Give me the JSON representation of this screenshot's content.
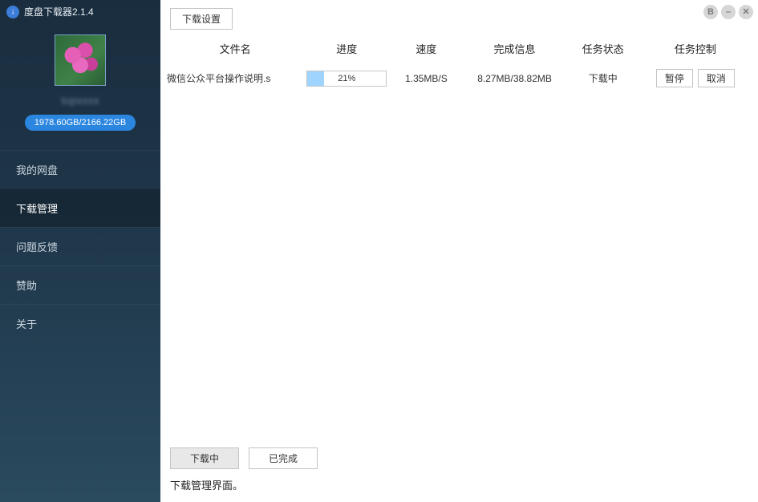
{
  "app": {
    "title": "度盘下载器2.1.4"
  },
  "profile": {
    "username": "topxxxx",
    "storage": "1978.60GB/2166.22GB"
  },
  "sidebar": {
    "items": [
      {
        "label": "我的网盘",
        "active": false
      },
      {
        "label": "下载管理",
        "active": true
      },
      {
        "label": "问题反馈",
        "active": false
      },
      {
        "label": "赞助",
        "active": false
      },
      {
        "label": "关于",
        "active": false
      }
    ]
  },
  "toolbar": {
    "settings_label": "下载设置"
  },
  "table": {
    "headers": {
      "name": "文件名",
      "progress": "进度",
      "speed": "速度",
      "info": "完成信息",
      "status": "任务状态",
      "control": "任务控制"
    },
    "rows": [
      {
        "name": "微信公众平台操作说明.s",
        "progress_percent": 21,
        "progress_text": "21%",
        "speed": "1.35MB/S",
        "info": "8.27MB/38.82MB",
        "status": "下载中",
        "pause_label": "暂停",
        "cancel_label": "取消"
      }
    ]
  },
  "footer": {
    "tabs": {
      "downloading": "下载中",
      "completed": "已完成"
    },
    "active_tab": "downloading",
    "caption": "下载管理界面。"
  },
  "window_controls": {
    "back": "B",
    "minimize": "–",
    "close": "✕"
  }
}
